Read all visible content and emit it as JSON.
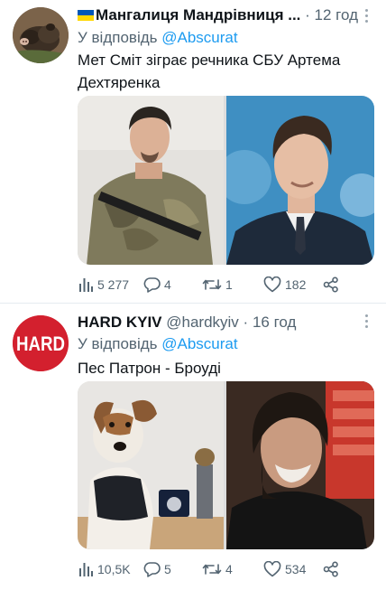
{
  "tweets": [
    {
      "author_name": "Мангалиця Мандрівниця ...",
      "time": "12 год",
      "reply_prefix": "У відповідь",
      "reply_to": "@Abscurat",
      "text": "Мет Сміт зіграє речника СБУ Артема Дехтяренка",
      "flag_colors": [
        "#0057b7",
        "#ffd700"
      ],
      "stats": {
        "views": "5 277",
        "replies": "4",
        "retweets": "1",
        "likes": "182"
      }
    },
    {
      "author_name": "HARD KYIV",
      "author_handle": "@hardkyiv",
      "dot": "·",
      "time": "16 год",
      "avatar_text": "HARD",
      "reply_prefix": "У відповідь",
      "reply_to": "@Abscurat",
      "text": "Пес Патрон - Броуді",
      "stats": {
        "views": "10,5K",
        "replies": "5",
        "retweets": "4",
        "likes": "534"
      }
    }
  ],
  "colors": {
    "link": "#1d9bf0",
    "muted": "#536471",
    "hard_red": "#d3202e"
  }
}
